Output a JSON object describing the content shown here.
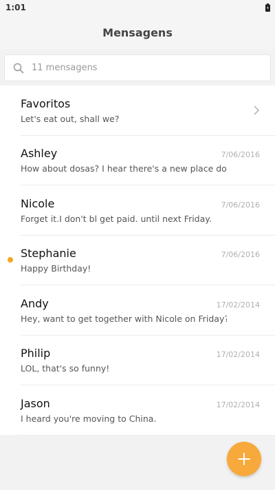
{
  "status_bar": {
    "time": "1:01",
    "battery_icon": "battery-icon"
  },
  "header": {
    "title": "Mensagens"
  },
  "search": {
    "placeholder": "11 mensagens",
    "icon": "search-icon"
  },
  "colors": {
    "accent": "#f7a93b",
    "unread": "#f5a623",
    "date": "#b0b0b0"
  },
  "messages": [
    {
      "name": "Favoritos",
      "preview": "Let's eat out, shall we?",
      "date": "",
      "chevron": true,
      "unread": false
    },
    {
      "name": "Ashley",
      "preview": "How about dosas? I hear there's a new place do…",
      "date": "7/06/2016",
      "chevron": false,
      "unread": false
    },
    {
      "name": "Nicole",
      "preview": "Forget it.I don't bl get paid. until next Friday.",
      "date": "7/06/2016",
      "chevron": false,
      "unread": false
    },
    {
      "name": "Stephanie",
      "preview": "Happy Birthday!",
      "date": "7/06/2016",
      "chevron": false,
      "unread": true
    },
    {
      "name": "Andy",
      "preview": "Hey, want to get together with Nicole on Friday?",
      "date": "17/02/2014",
      "chevron": false,
      "unread": false
    },
    {
      "name": "Philip",
      "preview": "LOL, that's so funny!",
      "date": "17/02/2014",
      "chevron": false,
      "unread": false
    },
    {
      "name": "Jason",
      "preview": "I heard you're moving to China.",
      "date": "17/02/2014",
      "chevron": false,
      "unread": false
    }
  ],
  "fab": {
    "icon": "plus-icon"
  }
}
